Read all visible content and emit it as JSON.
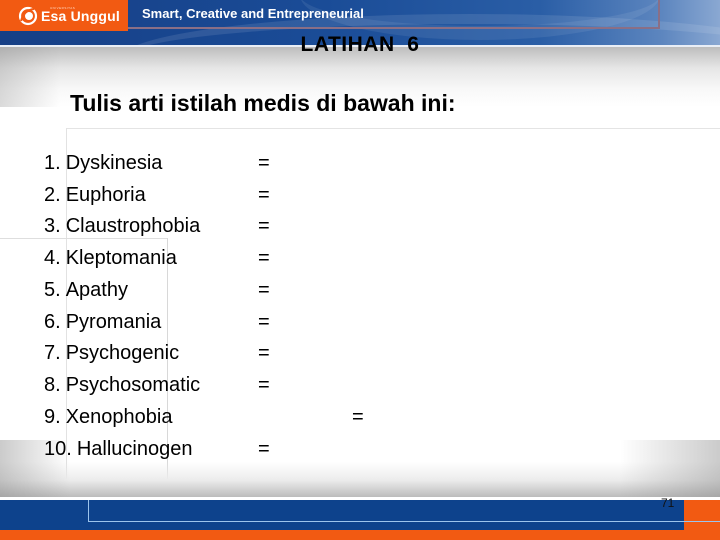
{
  "header": {
    "logo": {
      "icon": "esa-unggul-swirl-logo-icon",
      "sub_text": "UNIVERSITAS",
      "name": "Esa Unggul"
    },
    "tagline": "Smart, Creative and Entrepreneurial"
  },
  "slide": {
    "title": "LATIHAN  6",
    "instruction": "Tulis arti istilah medis di bawah ini:",
    "terms": [
      {
        "number": "1.",
        "term": "Dyskinesia",
        "separator": "="
      },
      {
        "number": "2.",
        "term": "Euphoria",
        "separator": "="
      },
      {
        "number": "3.",
        "term": "Claustrophobia",
        "separator": "="
      },
      {
        "number": "4.",
        "term": "Kleptomania",
        "separator": "="
      },
      {
        "number": "5.",
        "term": "Apathy",
        "separator": "="
      },
      {
        "number": "6.",
        "term": "Pyromania",
        "separator": "="
      },
      {
        "number": "7.",
        "term": "Psychogenic",
        "separator": "="
      },
      {
        "number": "8.",
        "term": "Psychosomatic",
        "separator": "="
      },
      {
        "number": "9.",
        "term": "Xenophobia",
        "separator": "="
      },
      {
        "number": "10.",
        "term": "Hallucinogen",
        "separator": "="
      }
    ]
  },
  "footer": {
    "page_number": "71"
  },
  "colors": {
    "brand_orange": "#f25a12",
    "brand_blue": "#0d428c",
    "header_blue": "#1a4c97",
    "text": "#000000"
  }
}
